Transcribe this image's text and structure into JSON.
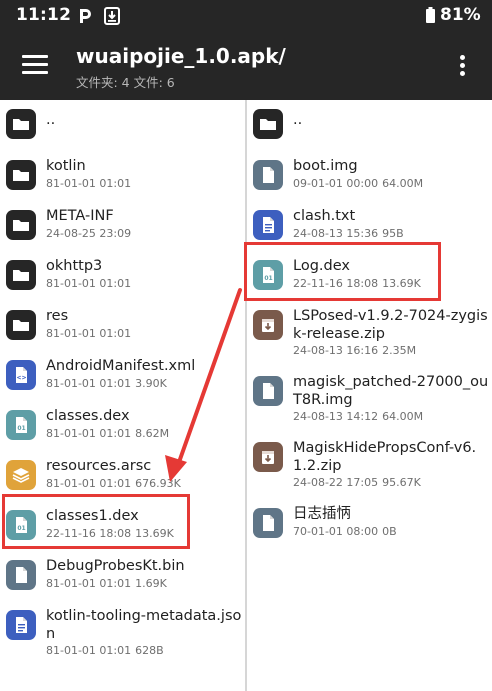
{
  "status_bar": {
    "time": "11:12",
    "battery_percent": "81%",
    "icons": [
      "p-icon",
      "download-icon",
      "battery-icon"
    ]
  },
  "app_bar": {
    "title": "wuaipojie_1.0.apk/",
    "subtitle": "文件夹: 4  文件: 6",
    "icons": [
      "menu-icon",
      "more-vert-icon"
    ]
  },
  "left_pane": {
    "items": [
      {
        "name": "..",
        "meta": "",
        "size": "",
        "icon": "folder-icon"
      },
      {
        "name": "kotlin",
        "meta": "81-01-01 01:01",
        "size": "",
        "icon": "folder-icon"
      },
      {
        "name": "META-INF",
        "meta": "24-08-25 23:09",
        "size": "",
        "icon": "folder-icon"
      },
      {
        "name": "okhttp3",
        "meta": "81-01-01 01:01",
        "size": "",
        "icon": "folder-icon"
      },
      {
        "name": "res",
        "meta": "81-01-01 01:01",
        "size": "",
        "icon": "folder-icon"
      },
      {
        "name": "AndroidManifest.xml",
        "meta": "81-01-01 01:01",
        "size": "3.90K",
        "icon": "xml-file-icon"
      },
      {
        "name": "classes.dex",
        "meta": "81-01-01 01:01",
        "size": "8.62M",
        "icon": "dex-file-icon"
      },
      {
        "name": "resources.arsc",
        "meta": "81-01-01 01:01",
        "size": "676.93K",
        "icon": "layers-file-icon"
      },
      {
        "name": "classes1.dex",
        "meta": "22-11-16 18:08",
        "size": "13.69K",
        "icon": "dex-file-icon"
      },
      {
        "name": "DebugProbesKt.bin",
        "meta": "81-01-01 01:01",
        "size": "1.69K",
        "icon": "generic-file-icon"
      },
      {
        "name": "kotlin-tooling-metadata.json",
        "meta": "81-01-01 01:01",
        "size": "628B",
        "icon": "text-file-icon"
      }
    ]
  },
  "right_pane": {
    "items": [
      {
        "name": "..",
        "meta": "",
        "size": "",
        "icon": "folder-icon"
      },
      {
        "name": "boot.img",
        "meta": "09-01-01 00:00",
        "size": "64.00M",
        "icon": "generic-file-icon"
      },
      {
        "name": "clash.txt",
        "meta": "24-08-13 15:36",
        "size": "95B",
        "icon": "text-file-icon"
      },
      {
        "name": "Log.dex",
        "meta": "22-11-16 18:08",
        "size": "13.69K",
        "icon": "dex-file-icon"
      },
      {
        "name": "LSPosed-v1.9.2-7024-zygisk-release.zip",
        "meta": "24-08-13 16:16",
        "size": "2.35M",
        "icon": "archive-file-icon"
      },
      {
        "name": "magisk_patched-27000_ouT8R.img",
        "meta": "24-08-13 14:12",
        "size": "64.00M",
        "icon": "generic-file-icon"
      },
      {
        "name": "MagiskHidePropsConf-v6.1.2.zip",
        "meta": "24-08-22 17:05",
        "size": "95.67K",
        "icon": "archive-file-icon"
      },
      {
        "name": "日志插怲",
        "meta": "70-01-01 08:00",
        "size": "0B",
        "icon": "generic-file-icon"
      }
    ]
  },
  "colors": {
    "bar_background": "#262626",
    "folder_icon": "#262626",
    "dex_icon": "#5e9ea6",
    "xml_icon": "#3d5fbf",
    "text_icon": "#3d5fbf",
    "generic_icon": "#5f7587",
    "archive_icon": "#7a5a4b",
    "layers_icon": "#e0a33a",
    "highlight": "#e53935",
    "arrow": "#e53935"
  }
}
